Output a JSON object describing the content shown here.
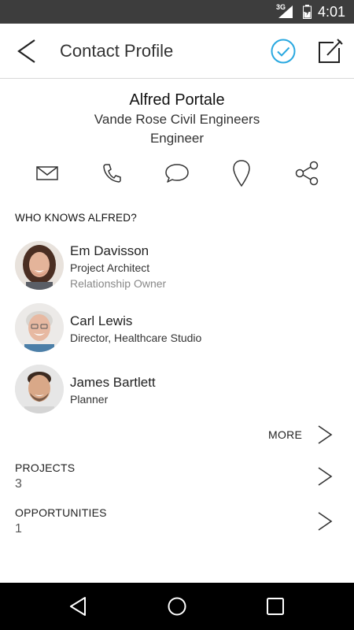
{
  "status_bar": {
    "network": "3G",
    "time": "4:01"
  },
  "app_bar": {
    "title": "Contact Profile",
    "back_icon": "back-chevron-icon",
    "confirm_icon": "check-circle-icon",
    "edit_icon": "edit-icon",
    "accent_color": "#29a8e0"
  },
  "contact": {
    "name": "Alfred Portale",
    "company": "Vande Rose Civil Engineers",
    "role": "Engineer"
  },
  "actions": [
    {
      "icon": "mail-icon"
    },
    {
      "icon": "phone-icon"
    },
    {
      "icon": "message-icon"
    },
    {
      "icon": "location-pin-icon"
    },
    {
      "icon": "share-icon"
    }
  ],
  "who_knows": {
    "label": "WHO KNOWS ALFRED?",
    "people": [
      {
        "name": "Em Davisson",
        "title": "Project Architect",
        "subtitle": "Relationship Owner"
      },
      {
        "name": "Carl Lewis",
        "title": "Director, Healthcare Studio"
      },
      {
        "name": "James Bartlett",
        "title": "Planner"
      }
    ],
    "more_label": "MORE"
  },
  "projects": {
    "label": "PROJECTS",
    "value": "3"
  },
  "opportunities": {
    "label": "OPPORTUNITIES",
    "value": "1"
  },
  "system_nav": {
    "back_icon": "nav-back-icon",
    "home_icon": "nav-home-icon",
    "recents_icon": "nav-recents-icon"
  }
}
